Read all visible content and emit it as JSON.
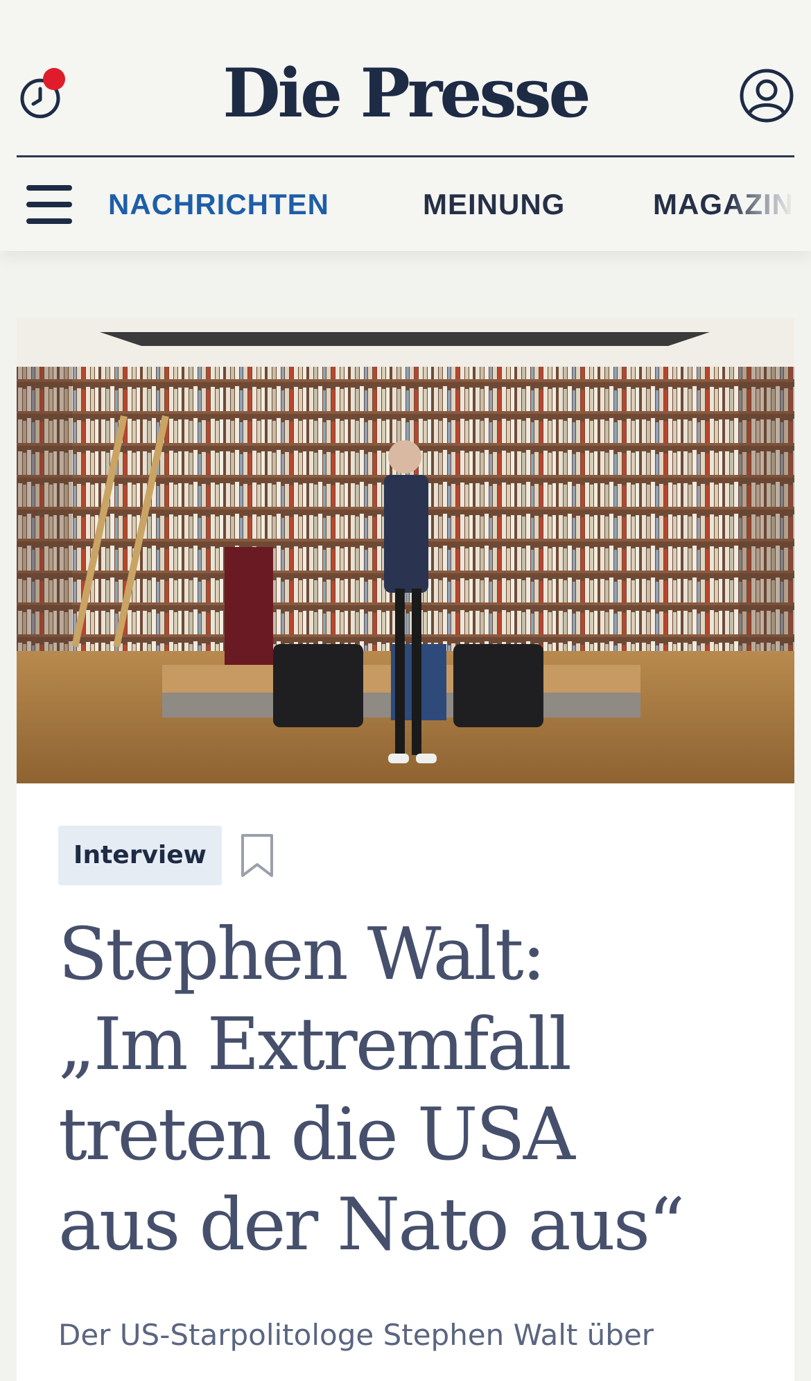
{
  "header": {
    "logo_text": "Die Presse",
    "history_icon": "history-clock-icon",
    "profile_icon": "user-profile-icon",
    "notification_dot_color": "#e01c2b"
  },
  "nav": {
    "menu_icon": "hamburger-menu-icon",
    "items": [
      {
        "label": "NACHRICHTEN",
        "active": true
      },
      {
        "label": "MEINUNG",
        "active": false
      },
      {
        "label": "MAGAZIN",
        "active": false
      }
    ]
  },
  "article": {
    "tag": "Interview",
    "bookmark_icon": "bookmark-icon",
    "headline_lines": [
      "Stephen Walt:",
      "„Im Extremfall",
      "treten die USA",
      "aus der Nato aus“"
    ],
    "lead": "Der US-Starpolitologe Stephen Walt über"
  },
  "colors": {
    "brand_navy": "#1d2b45",
    "nav_active": "#1e5ea8",
    "headline": "#46506c",
    "tag_bg": "#e6ecf3"
  }
}
